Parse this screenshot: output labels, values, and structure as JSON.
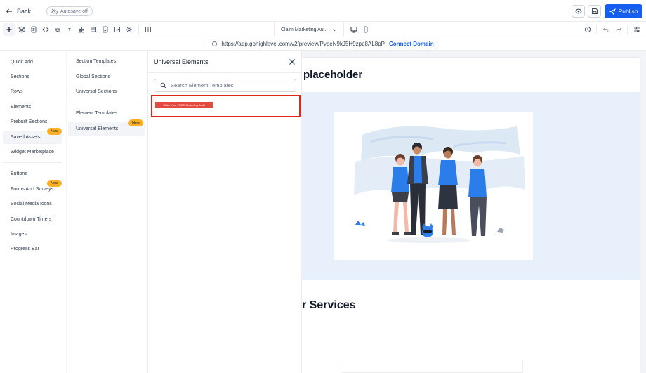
{
  "header": {
    "back_label": "Back",
    "autosave_label": "Autosave off",
    "publish_label": "Publish"
  },
  "toolbar": {
    "page_selector": "Claim Marketing Au..."
  },
  "url_bar": {
    "url": "https://app.gohighlevel.com/v2/preview/PypeN9kJ5H9zpq8AL8pP",
    "connect_domain": "Connect Domain"
  },
  "left_menu": {
    "items": [
      "Quick Add",
      "Sections",
      "Rows",
      "Elements",
      "Prebuilt Sections",
      "Saved Assets",
      "Widget Marketplace",
      "Buttons",
      "Forms And Surveys",
      "Social Media Icons",
      "Countdown Timers",
      "Images",
      "Progress Bar"
    ],
    "new_badge": "New"
  },
  "sub_menu": {
    "items": [
      "Section Templates",
      "Global Sections",
      "Universal Sections",
      "Element Templates",
      "Universal Elements"
    ],
    "new_badge": "New"
  },
  "panel": {
    "title": "Universal Elements",
    "search_placeholder": "Search Element Templates",
    "template_label": "Claim Your FREE Marketing Audit"
  },
  "preview": {
    "headline": "placeholder",
    "section_heading": "r Services"
  },
  "colors": {
    "accent": "#155eef",
    "highlight": "#e0251b",
    "badge": "#fdb022",
    "cta": "#e5483f"
  }
}
